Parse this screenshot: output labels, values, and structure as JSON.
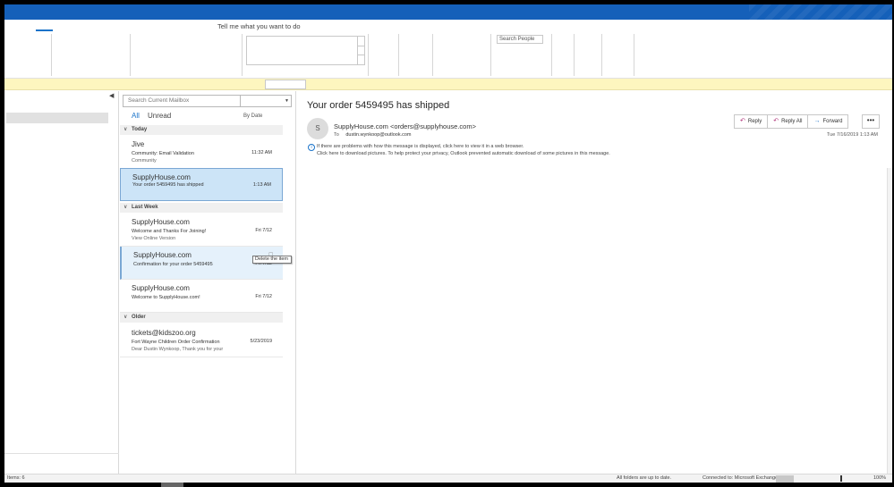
{
  "ribbon": {
    "tell_me": "Tell me what you want to do",
    "search_people_placeholder": "Search People"
  },
  "message_list": {
    "search_placeholder": "Search Current Mailbox",
    "filter_all": "All",
    "filter_unread": "Unread",
    "sort_label": "By Date",
    "groups": {
      "today": "Today",
      "last_week": "Last Week",
      "older": "Older"
    },
    "items": [
      {
        "sender": "Jive",
        "subject": "Community: Email Validation",
        "preview": "Community",
        "time": "11:32 AM"
      },
      {
        "sender": "SupplyHouse.com",
        "subject": "Your order 5459495 has shipped",
        "preview": "",
        "time": "1:13 AM"
      },
      {
        "sender": "SupplyHouse.com",
        "subject": "Welcome and Thanks For Joining!",
        "preview": "View Online Version",
        "time": "Fri 7/12"
      },
      {
        "sender": "SupplyHouse.com",
        "subject": "Confirmation for your order 5459495",
        "preview": "",
        "time": "Fri 7/12"
      },
      {
        "sender": "SupplyHouse.com",
        "subject": "Welcome to SupplyHouse.com!",
        "preview": "",
        "time": "Fri 7/12"
      },
      {
        "sender": "tickets@kidszoo.org",
        "subject": "Fort Wayne Children Order Confirmation",
        "preview": "Dear Dustin Wynkoop,  Thank you for your",
        "time": "5/23/2019"
      }
    ],
    "tooltip": "Delete the item"
  },
  "reading_pane": {
    "title": "Your order 5459495 has shipped",
    "avatar_initial": "S",
    "from": "SupplyHouse.com <orders@supplyhouse.com>",
    "to_label": "To",
    "to_address": "dustin.wynkoop@outlook.com",
    "info_line1": "If there are problems with how this message is displayed, click here to view it in a web browser.",
    "info_line2": "Click here to download pictures. To help protect your privacy, Outlook prevented automatic download of some pictures in this message.",
    "reply": "Reply",
    "reply_all": "Reply All",
    "forward": "Forward",
    "more": "•••",
    "sent_date": "Tue 7/16/2019 1:13 AM"
  },
  "statusbar": {
    "items": "Items: 6",
    "up_to_date": "All folders are up to date.",
    "connected": "Connected to: Microsoft Exchange",
    "zoom": "100%"
  },
  "colors": {
    "titlebar": "#1560b9",
    "accent": "#1a73c9",
    "infobar": "#fdf6bf",
    "selected_item": "#cce4f7"
  }
}
